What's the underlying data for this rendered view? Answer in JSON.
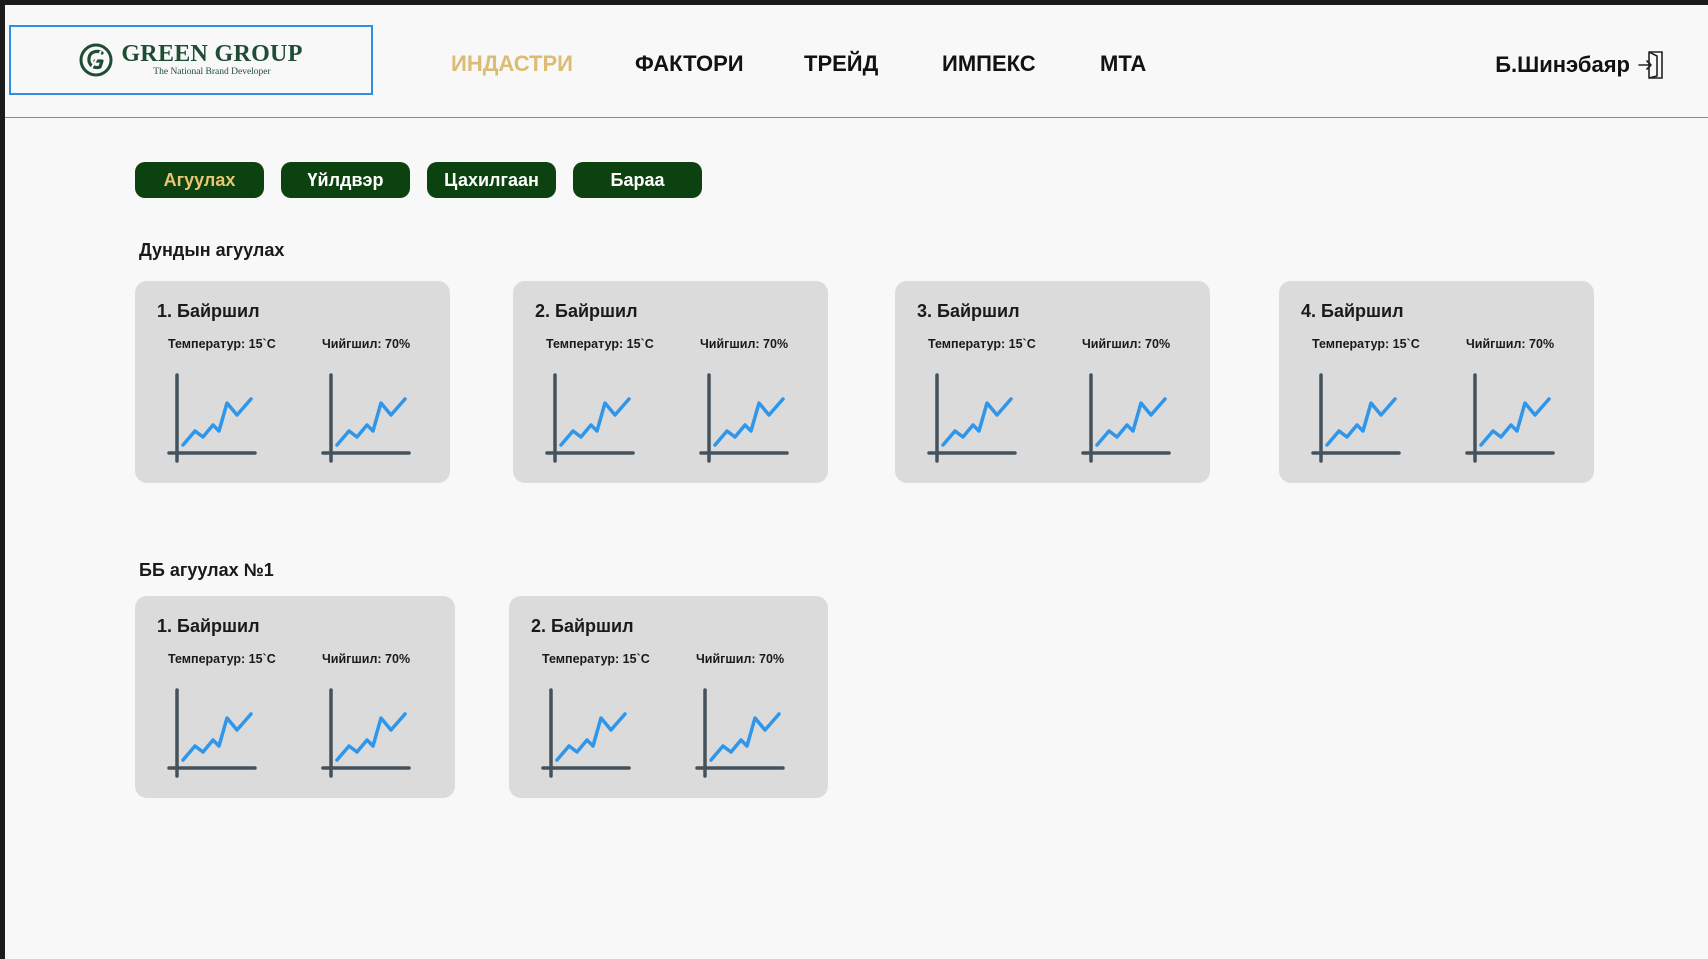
{
  "brand": {
    "name": "GREEN GROUP",
    "tagline": "The National Brand Developer"
  },
  "nav": [
    {
      "label": "ИНДАСТРИ",
      "active": true
    },
    {
      "label": "ФАКТОРИ",
      "active": false
    },
    {
      "label": "ТРЕЙД",
      "active": false
    },
    {
      "label": "ИМПЕКС",
      "active": false
    },
    {
      "label": "МТА",
      "active": false
    }
  ],
  "user": {
    "name": "Б.Шинэбаяр",
    "logout_icon": "logout-icon"
  },
  "tabs": [
    {
      "label": "Агуулах",
      "active": true
    },
    {
      "label": "Үйлдвэр",
      "active": false
    },
    {
      "label": "Цахилгаан",
      "active": false
    },
    {
      "label": "Бараа",
      "active": false
    }
  ],
  "sections": [
    {
      "title": "Дундын агуулах",
      "cards": [
        {
          "title": "1. Байршил",
          "temperature": "Температур: 15`C",
          "humidity": "Чийгшил: 70%"
        },
        {
          "title": "2. Байршил",
          "temperature": "Температур: 15`C",
          "humidity": "Чийгшил: 70%"
        },
        {
          "title": "3. Байршил",
          "temperature": "Температур: 15`C",
          "humidity": "Чийгшил: 70%"
        },
        {
          "title": "4. Байршил",
          "temperature": "Температур: 15`C",
          "humidity": "Чийгшил: 70%"
        }
      ]
    },
    {
      "title": "ББ агуулах №1",
      "cards": [
        {
          "title": "1. Байршил",
          "temperature": "Температур: 15`C",
          "humidity": "Чийгшил: 70%"
        },
        {
          "title": "2. Байршил",
          "temperature": "Температур: 15`C",
          "humidity": "Чийгшил: 70%"
        }
      ]
    }
  ],
  "colors": {
    "brand_green": "#1e4d33",
    "tab_bg": "#0b420f",
    "active_accent": "#dcbc74",
    "card_bg": "#dbdbdb",
    "chart_line": "#2f96ea",
    "chart_axis": "#44525c"
  }
}
